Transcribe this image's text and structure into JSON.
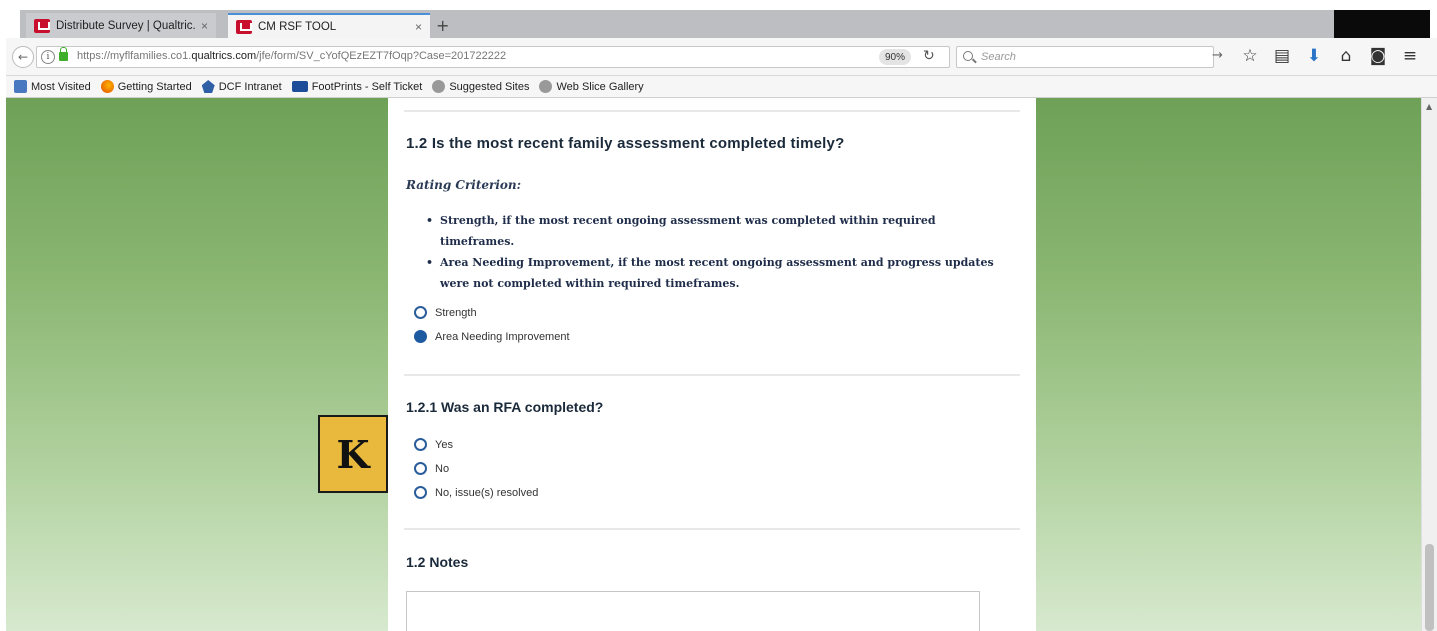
{
  "browser": {
    "tabs": [
      {
        "title": "Distribute Survey | Qualtric...",
        "close": "×",
        "active": false
      },
      {
        "title": "CM RSF TOOL",
        "close": "×",
        "active": true
      }
    ],
    "new_tab": "+",
    "url_prefix": "https://myflfamilies.co1.",
    "url_domain": "qualtrics.com",
    "url_path": "/jfe/form/SV_cYofQEzEZT7fOqp?Case=201722222",
    "zoom": "90%",
    "search_placeholder": "Search",
    "bookmarks": [
      {
        "label": "Most Visited",
        "icon": "most-visited-icon"
      },
      {
        "label": "Getting Started",
        "icon": "firefox-icon"
      },
      {
        "label": "DCF Intranet",
        "icon": "dcf-icon"
      },
      {
        "label": "FootPrints - Self Ticket",
        "icon": "footprints-icon"
      },
      {
        "label": "Suggested Sites",
        "icon": "globe-icon"
      },
      {
        "label": "Web Slice Gallery",
        "icon": "globe-icon"
      }
    ]
  },
  "survey": {
    "q1": {
      "title": "1.2  Is the most recent family assessment completed timely?",
      "rating_label": "Rating Criterion:",
      "criteria": [
        "Strength, if the most recent ongoing assessment was completed within required timeframes.",
        "Area Needing Improvement, if the most recent ongoing assessment and progress updates were not completed within required timeframes."
      ],
      "choices": [
        {
          "label": "Strength",
          "checked": false
        },
        {
          "label": "Area Needing Improvement",
          "checked": true
        }
      ]
    },
    "q121": {
      "title": "1.2.1 Was an RFA completed?",
      "choices": [
        {
          "label": "Yes",
          "checked": false
        },
        {
          "label": "No",
          "checked": false
        },
        {
          "label": "No, issue(s) resolved",
          "checked": false
        }
      ]
    },
    "notes": {
      "title": "1.2 Notes",
      "value": ""
    }
  },
  "badge": {
    "letter": "K",
    "color": "#e9b93e"
  },
  "colors": {
    "accent": "#1e5aa0",
    "background_top": "#6ea157",
    "background_bottom": "#d7e9ce"
  }
}
